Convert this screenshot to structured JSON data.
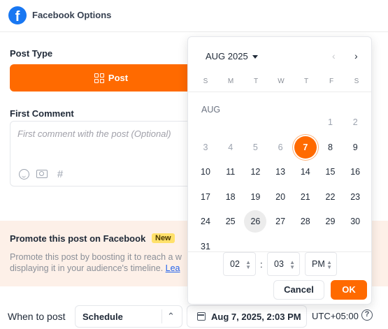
{
  "header": {
    "title": "Facebook Options",
    "logo_letter": "f",
    "logo_color": "#1877f2"
  },
  "post_type": {
    "label": "Post Type",
    "selected": "Post",
    "accent": "#ff6a00"
  },
  "first_comment": {
    "label": "First Comment",
    "placeholder": "First comment with the post (Optional)",
    "tools": [
      "smile-icon",
      "camera-icon",
      "hashtag-icon"
    ]
  },
  "promote": {
    "title": "Promote this post on Facebook",
    "badge": "New",
    "line1": "Promote this post by boosting it to reach a w",
    "line2": "displaying it in your audience's timeline.",
    "link": "Lea"
  },
  "schedule": {
    "when_label": "When to post",
    "mode": "Schedule",
    "datetime": "Aug 7, 2025, 2:03 PM",
    "timezone": "UTC+05:00"
  },
  "picker": {
    "month_year": "AUG 2025",
    "month_label": "AUG",
    "weekdays": [
      "S",
      "M",
      "T",
      "W",
      "T",
      "F",
      "S"
    ],
    "weeks": [
      [
        "",
        "",
        "",
        "",
        "",
        "1",
        "2"
      ],
      [
        "3",
        "4",
        "5",
        "6",
        "7",
        "8",
        "9"
      ],
      [
        "10",
        "11",
        "12",
        "13",
        "14",
        "15",
        "16"
      ],
      [
        "17",
        "18",
        "19",
        "20",
        "21",
        "22",
        "23"
      ],
      [
        "24",
        "25",
        "26",
        "27",
        "28",
        "29",
        "30"
      ],
      [
        "31",
        "",
        "",
        "",
        "",
        "",
        ""
      ]
    ],
    "selected_day": "7",
    "today_day": "26",
    "past_days": [
      "1",
      "2",
      "3",
      "4",
      "5",
      "6"
    ],
    "hour": "02",
    "minute": "03",
    "meridiem": "PM",
    "cancel_label": "Cancel",
    "ok_label": "OK"
  }
}
